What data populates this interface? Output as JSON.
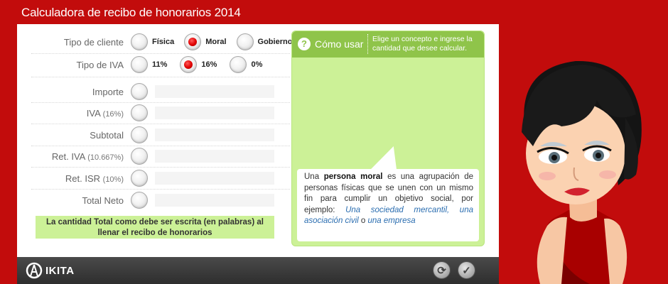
{
  "app": {
    "title": "Calculadora de recibo de honorarios 2014"
  },
  "client_type": {
    "label": "Tipo de cliente",
    "options": [
      {
        "label": "Física",
        "checked": false
      },
      {
        "label": "Moral",
        "checked": true
      },
      {
        "label": "Gobierno",
        "checked": false
      }
    ]
  },
  "iva_type": {
    "label": "Tipo de IVA",
    "options": [
      {
        "label": "11%",
        "checked": false
      },
      {
        "label": "16%",
        "checked": true
      },
      {
        "label": "0%",
        "checked": false
      }
    ]
  },
  "concepts": [
    {
      "label": "Importe",
      "note": "",
      "value": ""
    },
    {
      "label": "IVA",
      "note": "(16%)",
      "value": ""
    },
    {
      "label": "Subtotal",
      "note": "",
      "value": ""
    },
    {
      "label": "Ret. IVA",
      "note": "(10.667%)",
      "value": ""
    },
    {
      "label": "Ret. ISR",
      "note": "(10%)",
      "value": ""
    },
    {
      "label": "Total Neto",
      "note": "",
      "value": ""
    }
  ],
  "total_in_words": "La cantidad Total como debe ser escrita (en palabras) al llenar el recibo de honorarios",
  "help": {
    "icon": "?",
    "title": "Cómo usar",
    "hint": "Elige un concepto e ingrese la cantidad que desee calcular.",
    "bubble": {
      "text_1": "Una ",
      "term": "persona moral",
      "text_2": " es una agrupación de personas físicas que se unen con un mismo fin para cumplir un objetivo social, por ejemplo: ",
      "example_1": "Una sociedad mercantil, una asociación civil",
      "connector": " o ",
      "example_2": "una empresa"
    }
  },
  "footer": {
    "brand": "IKITA",
    "reset_icon": "refresh-icon",
    "confirm_icon": "check-icon"
  },
  "colors": {
    "background": "#c20c0c",
    "accent_green": "#8fc44a",
    "light_green": "#ccf197",
    "radio_checked": "#e00000"
  }
}
